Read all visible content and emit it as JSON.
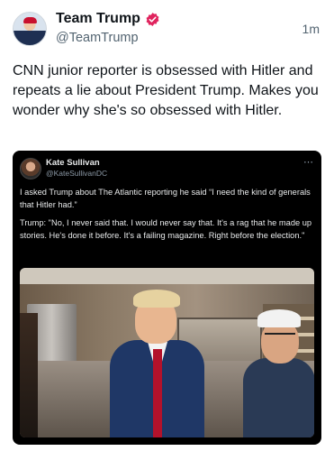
{
  "post": {
    "author": {
      "display_name": "Team Trump",
      "handle": "@TeamTrump",
      "verified_icon": "verified-badge-icon",
      "avatar": "avatar"
    },
    "timestamp": "1m",
    "text": "CNN junior reporter is obsessed with Hitler and repeats a lie about President Trump. Makes you wonder why she's so obsessed with Hitler."
  },
  "embedded_post": {
    "author": {
      "display_name": "Kate Sullivan",
      "handle": "@KateSullivanDC"
    },
    "more_icon": "more-options-icon",
    "paragraph_1": "I asked Trump about The Atlantic reporting he said “I need the kind of generals that Hitler had.”",
    "paragraph_2": "Trump: \"No, I never said that. I would never say that. It's a rag that he made up stories. He's done it before. It's a failing magazine. Right before the election.\""
  },
  "colors": {
    "text_primary": "#0f1419",
    "text_secondary": "#536471",
    "verified_badge": "#e0245e",
    "media_background": "#000000",
    "embed_text": "#e7e9ea"
  }
}
